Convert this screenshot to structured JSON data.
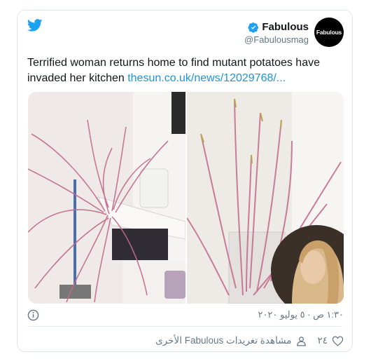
{
  "author": {
    "name": "Fabulous",
    "handle": "@Fabulousmag",
    "avatar_text": "Fabulous"
  },
  "tweet": {
    "text": "Terrified woman returns home to find mutant potatoes have invaded her kitchen ",
    "link": "thesun.co.uk/news/12029768/..."
  },
  "meta": {
    "timestamp": "١:٣٠ ص · ٥ يوليو ٢٠٢٠"
  },
  "actions": {
    "likes": "٢٤",
    "more_tweets": "مشاهدة تغريدات Fabulous الأخرى"
  },
  "icons": [
    "twitter-bird-icon",
    "verified-badge-icon",
    "info-icon",
    "heart-icon",
    "person-icon"
  ],
  "colors": {
    "brand_blue": "#1da1f2",
    "link": "#1b95e0",
    "secondary_text": "#657786",
    "border": "#e1e8ed"
  }
}
